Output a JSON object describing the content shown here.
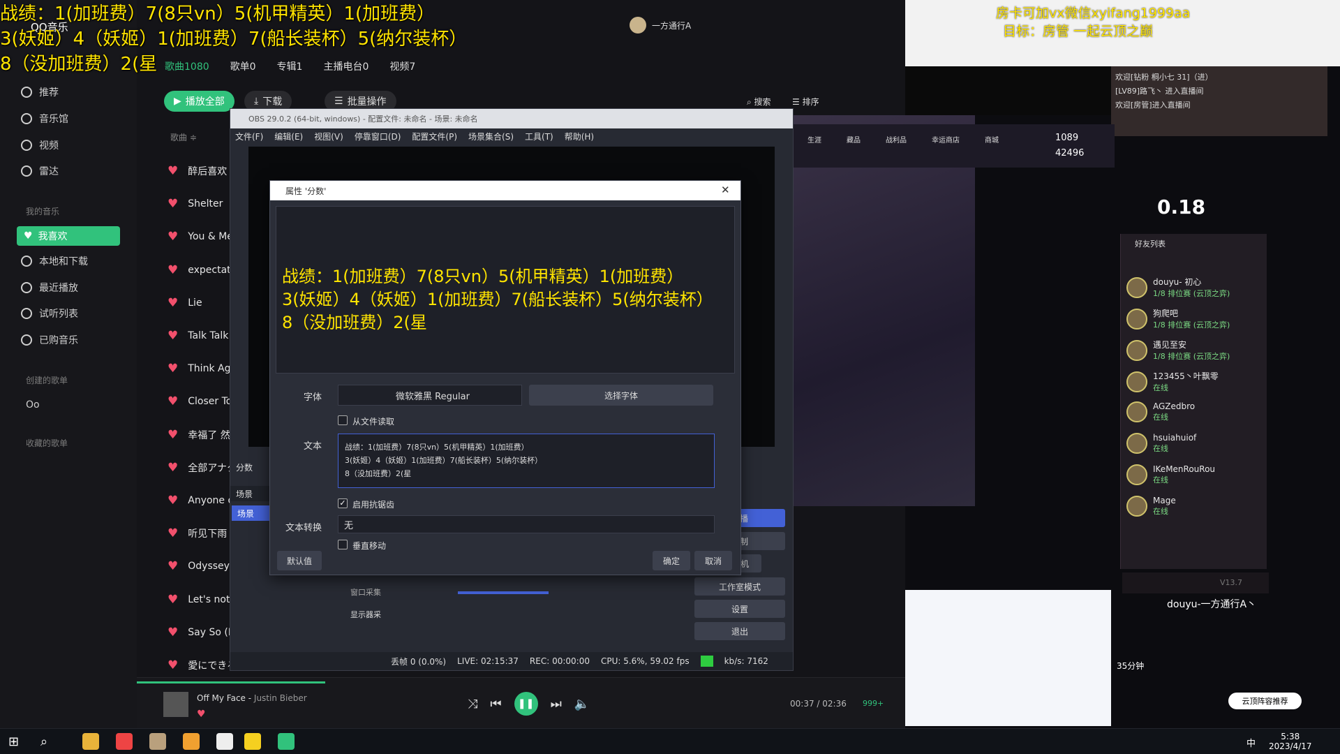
{
  "overlay": {
    "line1": "战绩：1(加班费）7(8只vn）5(机甲精英）1(加班费）",
    "line2": "3(妖姬）4（妖姬）1(加班费）7(船长装杯）5(纳尔装杯）",
    "line3": "8（没加班费）2(星"
  },
  "qq": {
    "app_name": "QQ音乐",
    "tabs": [
      "歌曲1080",
      "歌单0",
      "专辑1",
      "主播电台0",
      "视频7"
    ],
    "play_all": "播放全部",
    "download": "下载",
    "batch": "批量操作",
    "search": "搜索",
    "sort": "排序",
    "col_song": "歌曲 ≑",
    "sidebar": [
      "推荐",
      "音乐馆",
      "视频",
      "雷达"
    ],
    "my_music_label": "我的音乐",
    "my_music": [
      "我喜欢",
      "本地和下载",
      "最近播放",
      "试听列表",
      "已购音乐"
    ],
    "created_label": "创建的歌单",
    "created_item": "Oo",
    "collected_label": "收藏的歌单",
    "songs": [
      "醉后喜欢",
      "Shelter",
      "You & Me",
      "expectati",
      "Lie",
      "Talk Talk",
      "Think Aga",
      "Closer To",
      "幸福了 然",
      "全部アナタ",
      "Anyone o",
      "听见下雨",
      "Odyssey",
      "Let's not",
      "Say So (E",
      "愛にできる"
    ],
    "now_playing": "Off My Face",
    "artist": "Justin Bieber",
    "time": "00:37 / 02:36",
    "quality": "999+",
    "user": "一方通行A"
  },
  "obs": {
    "title": "OBS 29.0.2 (64-bit, windows) - 配置文件: 未命名 - 场景: 未命名",
    "menu": [
      "文件(F)",
      "编辑(E)",
      "视图(V)",
      "停靠窗口(D)",
      "配置文件(P)",
      "场景集合(S)",
      "工具(T)",
      "帮助(H)"
    ],
    "scene_header": "场景",
    "scene_item": "场景",
    "sources": [
      "窗口采集",
      "显示器采"
    ],
    "source_label": "分数",
    "right_buttons": [
      "直播",
      "录制",
      "虚拟摄像机",
      "工作室模式",
      "设置",
      "退出"
    ],
    "status": {
      "dropped": "丢帧 0 (0.0%)",
      "live": "LIVE: 02:15:37",
      "rec": "REC: 00:00:00",
      "cpu": "CPU: 5.6%, 59.02 fps",
      "kbps": "kb/s: 7162"
    }
  },
  "dialog": {
    "title": "属性 '分数'",
    "font_label": "字体",
    "font_value": "微软雅黑 Regular",
    "choose_font": "选择字体",
    "read_file": "从文件读取",
    "text_label": "文本",
    "text_value": "战绩：1(加班费）7(8只vn）5(机甲精英）1(加班费）\n3(妖姬）4（妖姬）1(加班费）7(船长装杯）5(纳尔装杯）\n8（没加班费）2(星",
    "antialias": "启用抗锯齿",
    "transform_label": "文本转换",
    "transform_value": "无",
    "vertical": "垂直移动",
    "defaults": "默认值",
    "ok": "确定",
    "cancel": "取消"
  },
  "right": {
    "banner1": "房卡可加vx微信xyifang1999aa",
    "banner2": "目标：房管 一起云顶之巅",
    "chat": [
      "欢迎[钻粉 桐小七 31]（进）",
      "[LV89]路飞丶 进入直播间",
      "欢迎[房管]进入直播间"
    ],
    "coins": "1089",
    "points": "42496",
    "shop": [
      "生涯",
      "藏品",
      "战利品",
      "幸运商店",
      "商城"
    ],
    "timer": "0.18",
    "friends_header": "好友列表",
    "friends": [
      {
        "name": "douyu- 初心",
        "status": "1/8 排位赛 (云顶之弈)"
      },
      {
        "name": "狗爬吧",
        "status": "1/8 排位赛 (云顶之弈)"
      },
      {
        "name": "遇见至安",
        "status": "1/8 排位赛 (云顶之弈)"
      },
      {
        "name": "123455丶叶飘零",
        "status": "在线"
      },
      {
        "name": "AGZedbro",
        "status": "在线"
      },
      {
        "name": "hsuiahuiof",
        "status": "在线"
      },
      {
        "name": "IKeMenRouRou",
        "status": "在线"
      },
      {
        "name": "Mage",
        "status": "在线"
      }
    ],
    "version": "V13.7",
    "player_name": "douyu-一方通行A丶",
    "duration": "35分钟",
    "recommend": "云顶阵容推荐"
  },
  "taskbar": {
    "time": "5:38",
    "date": "2023/4/17",
    "ime": "中"
  }
}
